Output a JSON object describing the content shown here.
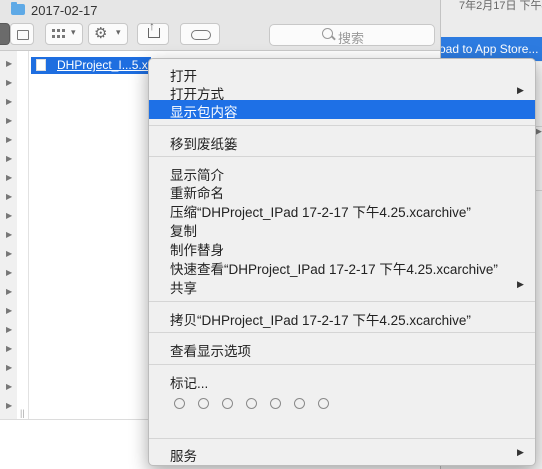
{
  "window": {
    "title": "2017-02-17"
  },
  "toolbar": {
    "search_placeholder": "搜索"
  },
  "file": {
    "name": "DHProject_I...5.xc..."
  },
  "background_window": {
    "date_text": "7年2月17日 下午4:2",
    "selected_text": "oad to App Store..."
  },
  "menu": {
    "open": "打开",
    "open_with": "打开方式",
    "show_package": "显示包内容",
    "move_to_trash": "移到废纸篓",
    "get_info": "显示简介",
    "rename": "重新命名",
    "compress": "压缩“DHProject_IPad 17-2-17 下午4.25.xcarchive”",
    "duplicate": "复制",
    "make_alias": "制作替身",
    "quick_look": "快速查看“DHProject_IPad 17-2-17 下午4.25.xcarchive”",
    "share": "共享",
    "copy": "拷贝“DHProject_IPad 17-2-17 下午4.25.xcarchive”",
    "view_options": "查看显示选项",
    "tags": "标记...",
    "services": "服务"
  },
  "icons": {
    "submenu_arrow": "▶",
    "disclosure": "▶",
    "gear": "⚙",
    "chevron": "▾"
  }
}
